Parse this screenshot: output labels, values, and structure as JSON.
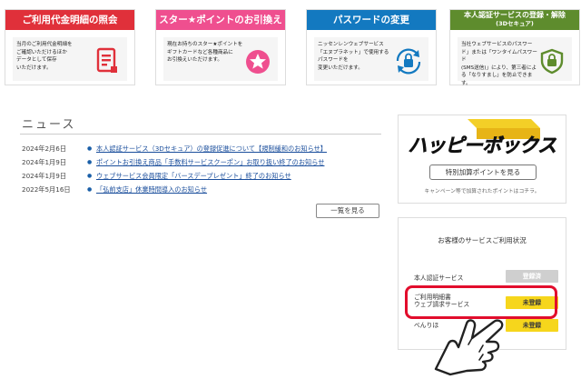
{
  "banners": [
    {
      "title": "ご利用代金明細の照会",
      "desc": "当月のご利用代金明細を\nご確認いただけるほか\nデータとして保存\nいただけます。",
      "icon": "statement-icon"
    },
    {
      "title": "スター★ポイントのお引換え",
      "desc": "現在お持ちのスター★ポイントを\nギフトカードなど各種商品に\nお引換えいただけます。",
      "icon": "star-icon"
    },
    {
      "title": "パスワードの変更",
      "desc": "ニッセンレンウェブサービス\n「エヌプラネット」で使用する\nパスワードを\n変更いただけます。",
      "icon": "lock-icon"
    },
    {
      "title": "本人認証サービスの登録・解除",
      "title_sub": "(3Dセキュア)",
      "desc": "当社ウェブサービスのパスワー\nド」または「ワンタイムパスワード\n(SMS送信)」により、第三者によ\nる「なりすまし」を防止できます。",
      "icon": "shield-check-icon"
    }
  ],
  "news": {
    "title": "ニュース",
    "items": [
      {
        "date": "2024年2月6日",
        "text": "本人認証サービス（3Dセキュア）の登録促進について【規制緩和のお知らせ】"
      },
      {
        "date": "2024年1月9日",
        "text": "ポイントお引換え商品「手数料サービスクーポン」お取り扱い終了のお知らせ"
      },
      {
        "date": "2024年1月9日",
        "text": "ウェブサービス会員限定「バースデープレゼント」終了のお知らせ"
      },
      {
        "date": "2022年5月16日",
        "text": "「弘前支店」休業時間導入のお知らせ"
      }
    ],
    "list_button": "一覧を見る"
  },
  "happy": {
    "logo_text": "ハッピーボックス",
    "button": "特別加算ポイントを見る",
    "note": "キャンペーン等で加算されたポイントはコチラ。"
  },
  "status": {
    "title": "お客様のサービスご利用状況",
    "rows": [
      {
        "label": "本人認証サービス",
        "badge": "登録済"
      },
      {
        "label_line1": "ご利用明細書",
        "label_line2": "ウェブ請求サービス",
        "badge": "未登録"
      },
      {
        "label": "べんりほ",
        "badge": "未登録"
      }
    ]
  },
  "colors": {
    "red": "#e0303a",
    "pink": "#ef4f8f",
    "blue": "#1379c0",
    "green": "#5e8c2d",
    "badge_yellow": "#f6d61c",
    "badge_gray": "#cfcfcf",
    "highlight": "#e20d2c"
  }
}
